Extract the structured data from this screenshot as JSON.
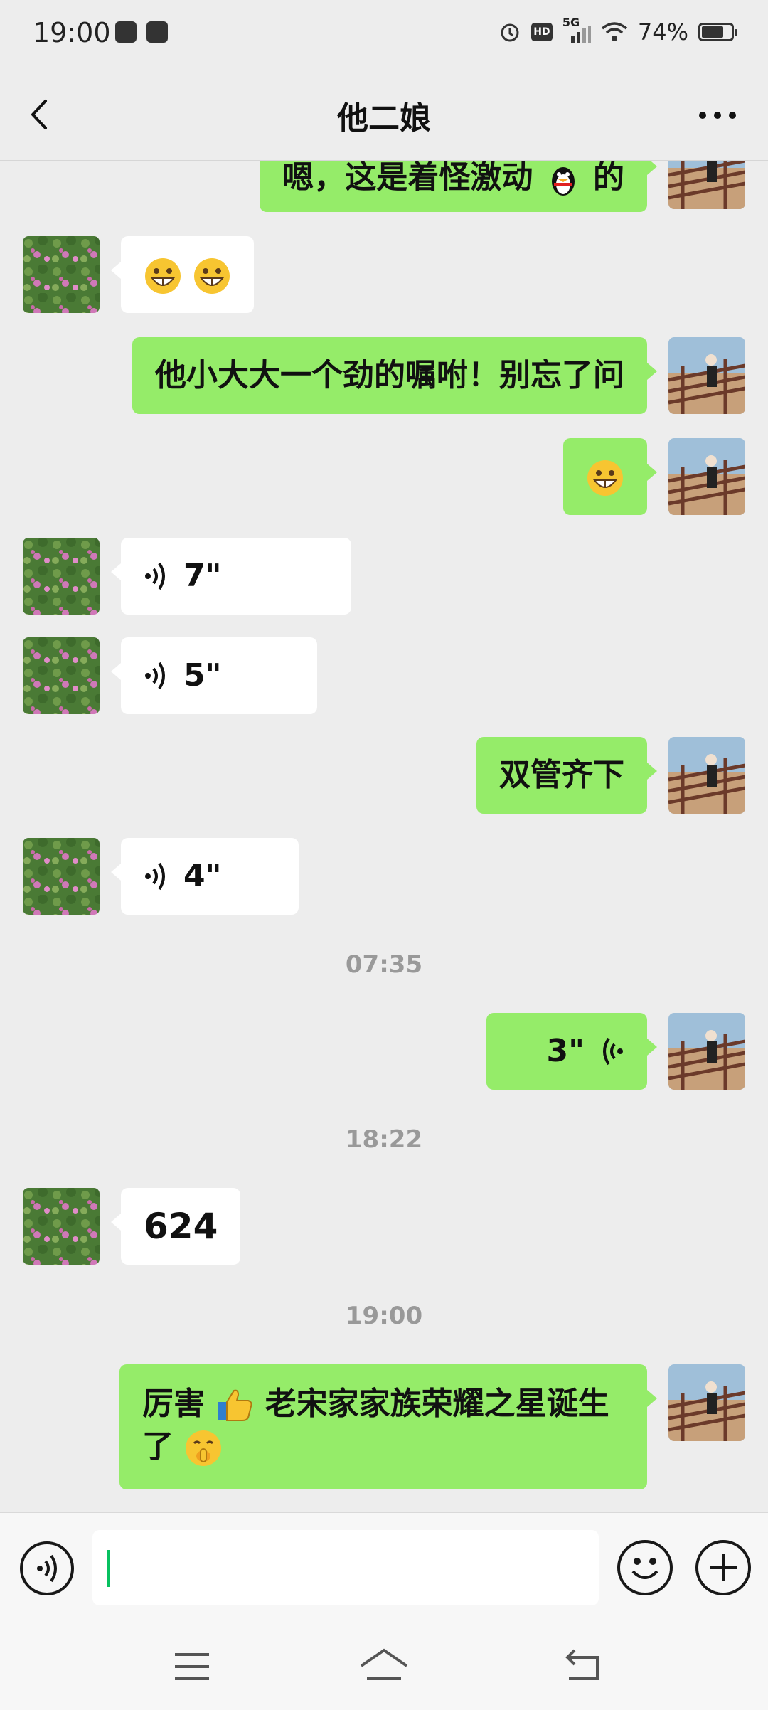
{
  "status_bar": {
    "time": "19:00",
    "network": "5G",
    "hd": "HD",
    "battery": "74%",
    "battery_level": 0.74
  },
  "header": {
    "title": "他二娘",
    "back_icon": "chevron-left-icon",
    "more_icon": "more-dots-icon"
  },
  "messages": [
    {
      "from": "me",
      "text": "嗯，这是着怪激动",
      "emoji": "penguin-emoji",
      "suffix": "的"
    },
    {
      "from": "other",
      "emojis": [
        "grin-emoji",
        "grin-emoji"
      ]
    },
    {
      "from": "me",
      "text": "他小大大一个劲的嘱咐！别忘了问"
    },
    {
      "from": "me",
      "emojis": [
        "grin-emoji"
      ]
    },
    {
      "from": "other",
      "voice": "7\""
    },
    {
      "from": "other",
      "voice": "5\""
    },
    {
      "from": "me",
      "text": "双管齐下"
    },
    {
      "from": "other",
      "voice": "4\""
    },
    {
      "timestamp": "07:35"
    },
    {
      "from": "me",
      "voice": "3\""
    },
    {
      "timestamp": "18:22"
    },
    {
      "from": "other",
      "text": "624"
    },
    {
      "timestamp": "19:00"
    },
    {
      "from": "me",
      "text_a": "厉害",
      "emoji_a": "thumbs-up-emoji",
      "text_b": " 老宋家家族荣耀之星诞生",
      "text_c": "了",
      "emoji_b": "shushing-face-emoji"
    }
  ],
  "input_bar": {
    "voice_icon": "voice-mode-icon",
    "emoji_icon": "smiley-icon",
    "plus_icon": "plus-icon",
    "value": ""
  },
  "nav_bar": {
    "menu_icon": "menu-icon",
    "home_icon": "home-icon",
    "back_icon": "back-icon"
  }
}
